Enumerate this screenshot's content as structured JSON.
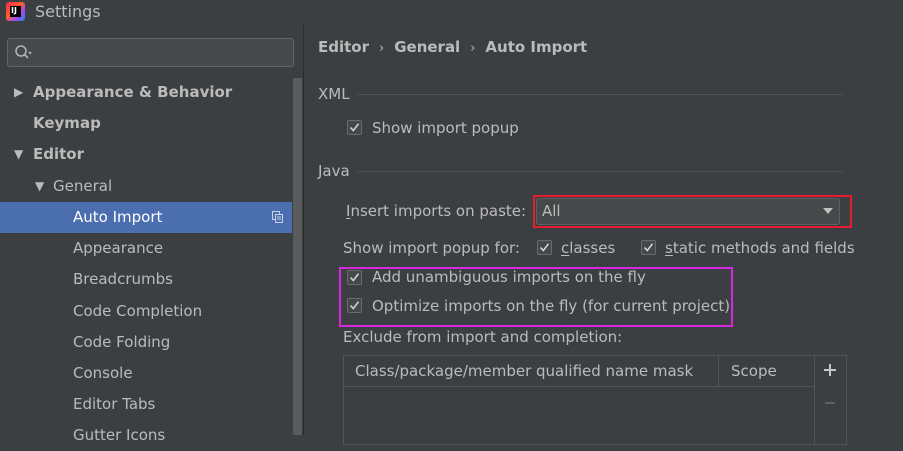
{
  "window": {
    "title": "Settings",
    "app_icon_label": "IJ"
  },
  "search": {
    "placeholder": ""
  },
  "tree": [
    {
      "label": "Appearance & Behavior",
      "arrow": "▶",
      "bold": true
    },
    {
      "label": "Keymap",
      "arrow": "",
      "bold": true
    },
    {
      "label": "Editor",
      "arrow": "▼",
      "bold": true
    },
    {
      "label": "General",
      "arrow": "▼",
      "bold": false
    },
    {
      "label": "Auto Import",
      "arrow": "",
      "bold": false,
      "selected": true
    },
    {
      "label": "Appearance",
      "arrow": "",
      "bold": false
    },
    {
      "label": "Breadcrumbs",
      "arrow": "",
      "bold": false
    },
    {
      "label": "Code Completion",
      "arrow": "",
      "bold": false
    },
    {
      "label": "Code Folding",
      "arrow": "",
      "bold": false
    },
    {
      "label": "Console",
      "arrow": "",
      "bold": false
    },
    {
      "label": "Editor Tabs",
      "arrow": "",
      "bold": false
    },
    {
      "label": "Gutter Icons",
      "arrow": "",
      "bold": false
    }
  ],
  "breadcrumb": {
    "items": [
      "Editor",
      "General",
      "Auto Import"
    ],
    "separator": "›"
  },
  "xml": {
    "title": "XML",
    "show_import_popup": {
      "label": "Show import popup",
      "checked": true
    }
  },
  "java": {
    "title": "Java",
    "insert_on_paste": {
      "label_pre": "",
      "label_mnemonic": "I",
      "label_post": "nsert imports on paste:",
      "value": "All"
    },
    "show_popup_for": {
      "label": "Show import popup for:",
      "classes": {
        "mnemonic": "c",
        "rest": "lasses",
        "checked": true
      },
      "static": {
        "mnemonic": "s",
        "rest": "tatic methods and fields",
        "checked": true
      }
    },
    "add_unambiguous": {
      "label": "Add unambiguous imports on the fly",
      "checked": true
    },
    "optimize": {
      "label": "Optimize imports on the fly (for current project)",
      "checked": true
    },
    "exclude": {
      "label": "Exclude from import and completion:",
      "columns": [
        "Class/package/member qualified name mask",
        "Scope"
      ],
      "add": "+",
      "remove": "−"
    }
  },
  "colors": {
    "selection": "#4b6eaf",
    "highlight_red": "#e81c30",
    "highlight_magenta": "#d728e0"
  }
}
